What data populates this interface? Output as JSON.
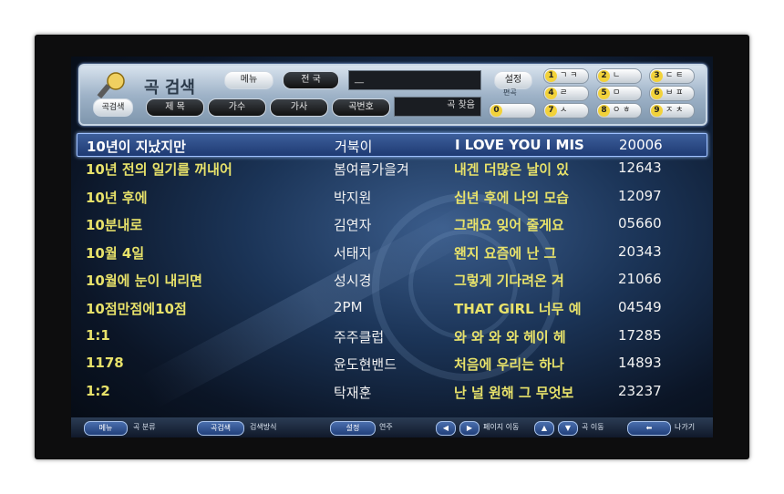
{
  "panel": {
    "title": "곡 검색",
    "btn_menu": "메뉴",
    "btn_nation": "전 국",
    "search_value": "__",
    "btn_setting": "설정",
    "setting_sub": "편곡",
    "tabs": [
      "곡검색",
      "제 목",
      "가수",
      "가사",
      "곡번호"
    ],
    "search_label": "곡 찾음",
    "keypad": [
      {
        "num": "1",
        "label": "ㄱ ㅋ"
      },
      {
        "num": "2",
        "label": "ㄴ"
      },
      {
        "num": "3",
        "label": "ㄷ ㅌ"
      },
      {
        "num": "4",
        "label": "ㄹ"
      },
      {
        "num": "5",
        "label": "ㅁ"
      },
      {
        "num": "6",
        "label": "ㅂ ㅍ"
      },
      {
        "num": "0",
        "label": ""
      },
      {
        "num": "7",
        "label": "ㅅ"
      },
      {
        "num": "8",
        "label": "ㅇ ㅎ"
      },
      {
        "num": "9",
        "label": "ㅈ ㅊ"
      }
    ]
  },
  "songs": [
    {
      "title": "10년이 지났지만",
      "artist": "거북이",
      "lyric": "I LOVE YOU I MIS",
      "number": "20006"
    },
    {
      "title": "10년 전의 일기를 꺼내어",
      "artist": "봄여름가을겨",
      "lyric": "내겐 더많은 날이 있",
      "number": "12643"
    },
    {
      "title": "10년 후에",
      "artist": "박지원",
      "lyric": "십년 후에 나의 모습",
      "number": "12097"
    },
    {
      "title": "10분내로",
      "artist": "김연자",
      "lyric": "그래요 잊어 줄게요",
      "number": "05660"
    },
    {
      "title": "10월 4일",
      "artist": "서태지",
      "lyric": "왠지 요즘에 난 그",
      "number": "20343"
    },
    {
      "title": "10월에 눈이 내리면",
      "artist": "성시경",
      "lyric": "그렇게 기다려온 겨",
      "number": "21066"
    },
    {
      "title": "10점만점에10점",
      "artist": "2PM",
      "lyric": "THAT GIRL 너무 예",
      "number": "04549"
    },
    {
      "title": "1:1",
      "artist": "주주클럽",
      "lyric": "와 와 와 와 헤이 헤",
      "number": "17285"
    },
    {
      "title": "1178",
      "artist": "윤도현밴드",
      "lyric": "처음에 우리는 하나",
      "number": "14893"
    },
    {
      "title": "1:2",
      "artist": "탁재훈",
      "lyric": "난 널 원해 그 무엇보",
      "number": "23237"
    }
  ],
  "bottom_bar": {
    "menu_btn": "메뉴",
    "menu_label": "곡 분류",
    "search_btn": "곡검색",
    "search_label": "검색방식",
    "setting_btn": "설정",
    "setting_label": "연주",
    "page_label": "페이지 이동",
    "song_label": "곡 이동",
    "exit_label": "나가기"
  },
  "colors": {
    "title_text": "#e8e26a",
    "artist_text": "#f2f2f2",
    "highlight": "#2d4d8a"
  }
}
